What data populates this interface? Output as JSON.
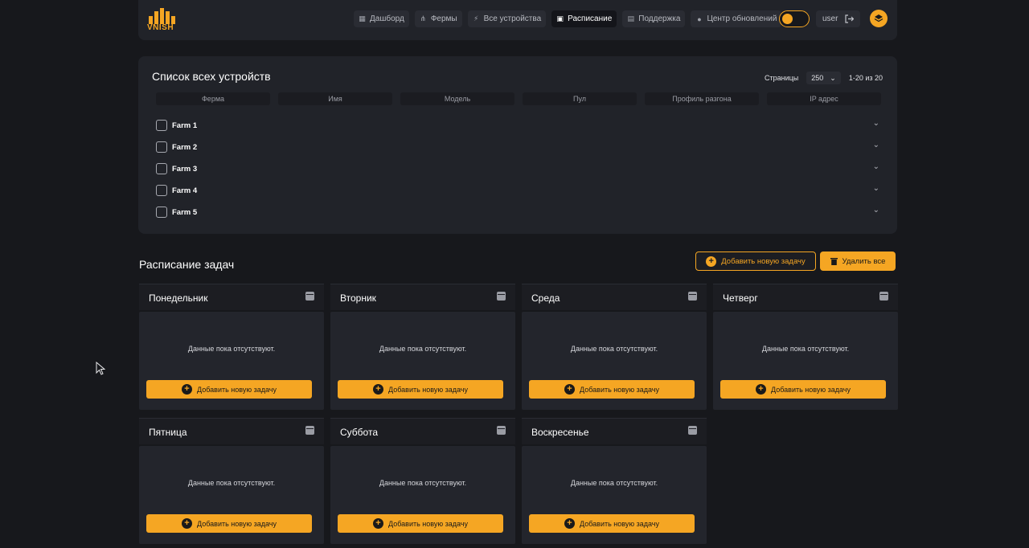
{
  "brand": {
    "logo_text": "VNISH",
    "accent": "#f5a623"
  },
  "nav": [
    {
      "label": "Дашборд",
      "icon": "grid-icon",
      "glyph": "▦",
      "active": false
    },
    {
      "label": "Фермы",
      "icon": "network-icon",
      "glyph": "⋔",
      "active": false
    },
    {
      "label": "Все устройства",
      "icon": "lightning-icon",
      "glyph": "⚡",
      "active": false
    },
    {
      "label": "Расписание",
      "icon": "calendar-icon",
      "glyph": "▣",
      "active": true
    },
    {
      "label": "Поддержка",
      "icon": "chat-icon",
      "glyph": "▤",
      "active": false
    },
    {
      "label": "Центр обновлений",
      "icon": "update-icon",
      "glyph": "●",
      "active": false
    }
  ],
  "header": {
    "user": "user"
  },
  "devices": {
    "title": "Список всех устройств",
    "pager_label": "Страницы",
    "page_size": "250",
    "range": "1-20 из 20",
    "columns": [
      "Ферма",
      "Имя",
      "Модель",
      "Пул",
      "Профиль разгона",
      "IP адрес"
    ],
    "farms": [
      "Farm 1",
      "Farm 2",
      "Farm 3",
      "Farm 4",
      "Farm 5"
    ]
  },
  "schedule": {
    "title": "Расписание задач",
    "add_label": "Добавить новую задачу",
    "delete_all_label": "Удалить все",
    "empty_text": "Данные пока отсутствуют.",
    "day_add_label": "Добавить новую задачу",
    "days": [
      "Понедельник",
      "Вторник",
      "Среда",
      "Четверг",
      "Пятница",
      "Суббота",
      "Воскресенье"
    ]
  }
}
